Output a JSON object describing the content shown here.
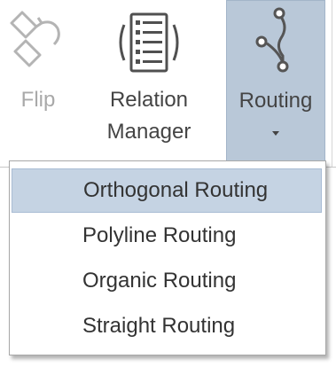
{
  "ribbon": {
    "flip": {
      "label": "Flip",
      "icon": "flip-icon",
      "enabled": false
    },
    "relation_manager": {
      "line1": "Relation",
      "line2": "Manager",
      "icon": "relation-manager-icon"
    },
    "routing": {
      "label": "Routing",
      "icon": "routing-icon",
      "pressed": true
    }
  },
  "dropdown": {
    "items": [
      {
        "label": "Orthogonal Routing",
        "highlighted": true
      },
      {
        "label": "Polyline Routing"
      },
      {
        "label": "Organic Routing"
      },
      {
        "label": "Straight Routing"
      }
    ]
  },
  "colors": {
    "pressed_bg": "#b9c8d8",
    "highlight_bg": "#c5d3e3",
    "disabled_text": "#a9a9a9",
    "text": "#444444"
  }
}
